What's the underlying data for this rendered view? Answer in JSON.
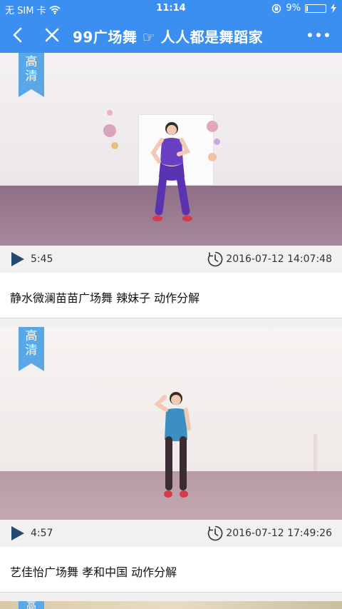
{
  "status_bar": {
    "carrier": "无 SIM 卡",
    "time": "11:14",
    "battery_percent": "9%",
    "battery_level": 0.09
  },
  "nav": {
    "title": "99广场舞 ☞ 人人都是舞蹈家"
  },
  "videos": [
    {
      "badge": [
        "高",
        "清"
      ],
      "duration": "5:45",
      "datetime": "2016-07-12 14:07:48",
      "title": "静水微澜苗苗广场舞 辣妹子 动作分解"
    },
    {
      "badge": [
        "高",
        "清"
      ],
      "duration": "4:57",
      "datetime": "2016-07-12 17:49:26",
      "title": "艺佳怡广场舞 孝和中国 动作分解"
    },
    {
      "badge": [
        "高"
      ]
    }
  ],
  "colors": {
    "header": "#3b8ff0",
    "badge": "#5aa7e6",
    "play_icon": "#244a70"
  }
}
